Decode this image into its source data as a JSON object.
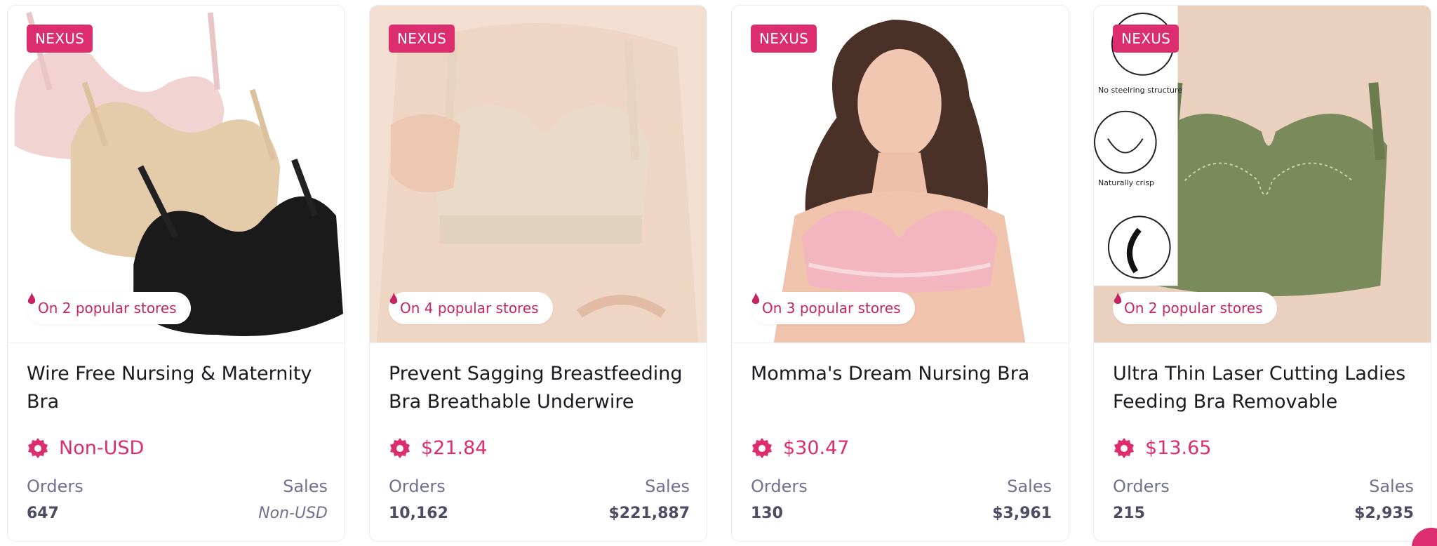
{
  "colors": {
    "accent": "#dc2d6f",
    "muted": "#6f7390",
    "value": "#4a4d63",
    "title": "#1a1a22"
  },
  "icons": {
    "flame": "flame-icon",
    "badge": "gear-badge-icon"
  },
  "products": [
    {
      "brand": "NEXUS",
      "stores": "On 2 popular stores",
      "title": "Wire Free Nursing & Maternity Bra",
      "price": "Non-USD",
      "orders_label": "Orders",
      "sales_label": "Sales",
      "orders": "647",
      "sales": "Non-USD"
    },
    {
      "brand": "NEXUS",
      "stores": "On 4 popular stores",
      "title": "Prevent Sagging Breastfeeding Bra Breathable Underwire",
      "price": "$21.84",
      "orders_label": "Orders",
      "sales_label": "Sales",
      "orders": "10,162",
      "sales": "$221,887"
    },
    {
      "brand": "NEXUS",
      "stores": "On 3 popular stores",
      "title": "Momma's Dream Nursing Bra",
      "price": "$30.47",
      "orders_label": "Orders",
      "sales_label": "Sales",
      "orders": "130",
      "sales": "$3,961"
    },
    {
      "brand": "NEXUS",
      "stores": "On 2 popular stores",
      "title": "Ultra Thin Laser Cutting Ladies Feeding Bra Removable",
      "price": "$13.65",
      "orders_label": "Orders",
      "sales_label": "Sales",
      "orders": "215",
      "sales": "$2,935",
      "diagram_labels": [
        "No steelring structure",
        "Naturally crisp"
      ]
    }
  ]
}
